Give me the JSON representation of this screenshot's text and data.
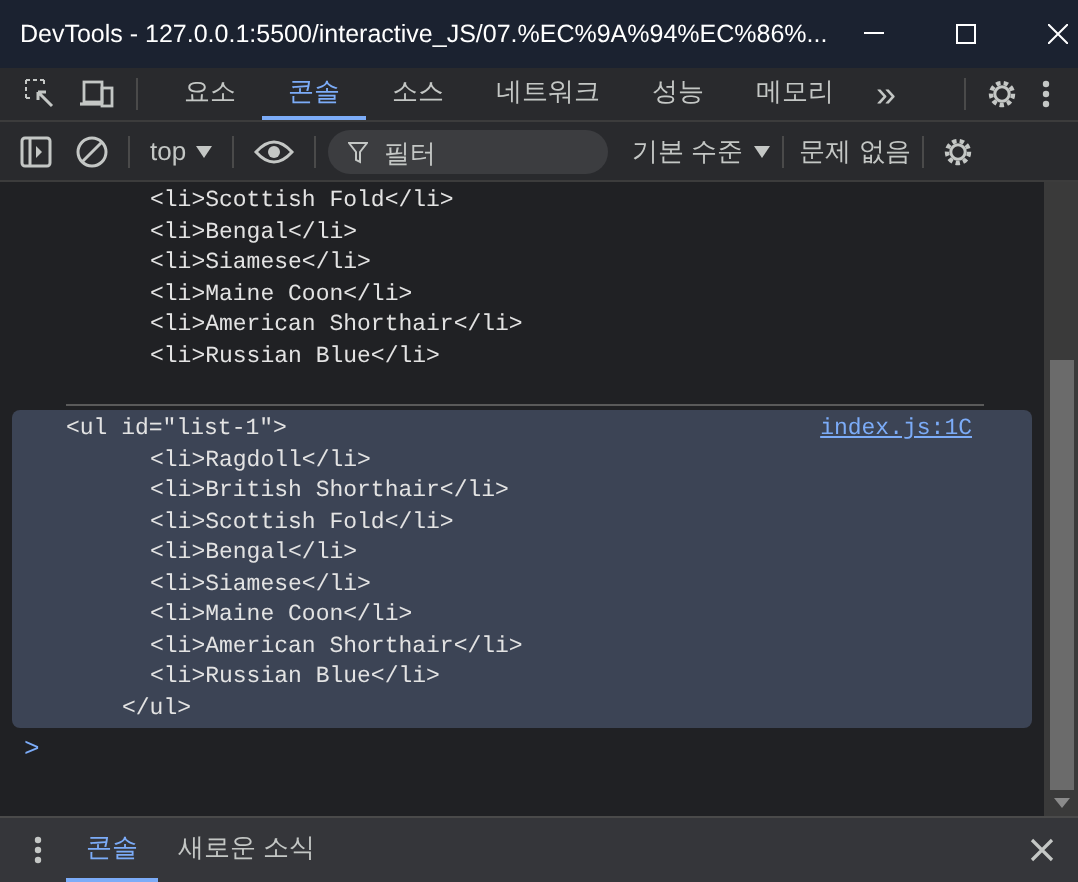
{
  "window": {
    "title": "DevTools - 127.0.0.1:5500/interactive_JS/07.%EC%9A%94%EC%86%..."
  },
  "tabs": [
    {
      "label": "요소",
      "selected": false
    },
    {
      "label": "콘솔",
      "selected": true
    },
    {
      "label": "소스",
      "selected": false
    },
    {
      "label": "네트워크",
      "selected": false
    },
    {
      "label": "성능",
      "selected": false
    },
    {
      "label": "메모리",
      "selected": false
    }
  ],
  "more_tabs": "»",
  "toolbar": {
    "context": "top",
    "filter": {
      "placeholder": "필터"
    },
    "levels": "기본 수준",
    "issues": "문제 없음"
  },
  "messages": [
    {
      "selected": false,
      "children": [
        "<li>Scottish Fold</li>",
        "<li>Bengal</li>",
        "<li>Siamese</li>",
        "<li>Maine Coon</li>",
        "<li>American Shorthair</li>",
        "<li>Russian Blue</li>"
      ]
    },
    {
      "selected": true,
      "open": "<ul id=\"list-1\">",
      "source": "index.js:1C",
      "children": [
        "<li>Ragdoll</li>",
        "<li>British Shorthair</li>",
        "<li>Scottish Fold</li>",
        "<li>Bengal</li>",
        "<li>Siamese</li>",
        "<li>Maine Coon</li>",
        "<li>American Shorthair</li>",
        "<li>Russian Blue</li>"
      ],
      "close": "</ul>"
    }
  ],
  "prompt": ">",
  "drawer_tabs": [
    {
      "label": "콘솔",
      "selected": true
    },
    {
      "label": "새로운 소식",
      "selected": false
    }
  ]
}
